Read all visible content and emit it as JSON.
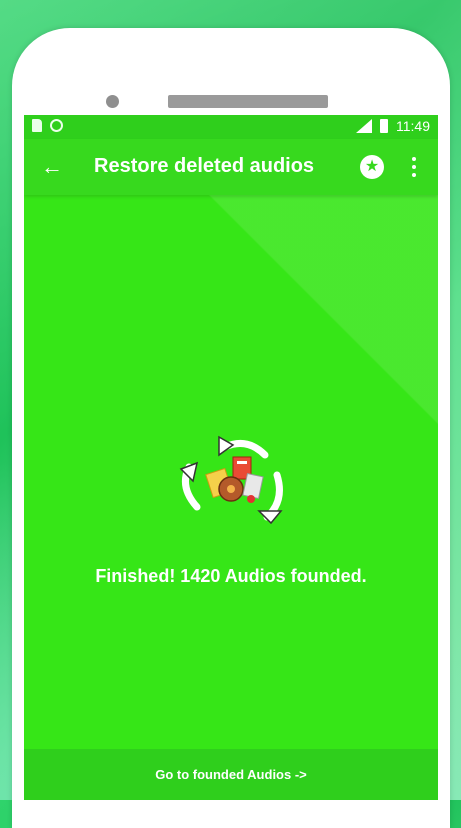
{
  "status_bar": {
    "time": "11:49"
  },
  "app_bar": {
    "back_icon": "arrow-left-icon",
    "title": "Restore deleted audios",
    "star_icon": "star-circle-icon",
    "more_icon": "more-vert-icon"
  },
  "main": {
    "graphic_icon": "recycle-audio-icon",
    "message": "Finished! 1420 Audios founded."
  },
  "bottom_button": {
    "label": "Go to founded Audios ->"
  },
  "colors": {
    "primary": "#36e617",
    "primary_dark": "#2fcf1c",
    "text": "#ffffff"
  }
}
